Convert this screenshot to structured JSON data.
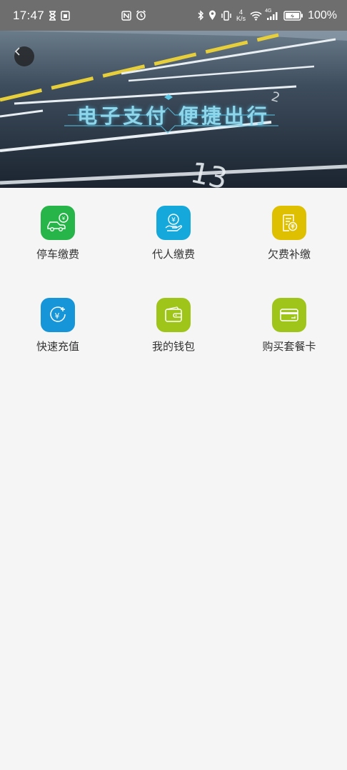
{
  "status_bar": {
    "time": "17:47",
    "net_speed_value": "4",
    "net_speed_unit": "K/s",
    "network_type": "4G",
    "battery": "100%"
  },
  "banner": {
    "title": "电子支付 便捷出行"
  },
  "services": [
    {
      "label": "停车缴费",
      "color": "#27b54a",
      "icon": "car-yuan-icon"
    },
    {
      "label": "代人缴费",
      "color": "#14a8db",
      "icon": "hand-yuan-icon"
    },
    {
      "label": "欠费补缴",
      "color": "#dfc000",
      "icon": "bill-icon"
    },
    {
      "label": "快速充值",
      "color": "#1795d9",
      "icon": "recharge-icon"
    },
    {
      "label": "我的钱包",
      "color": "#9fc41a",
      "icon": "wallet-icon"
    },
    {
      "label": "购买套餐卡",
      "color": "#9fc41a",
      "icon": "card-icon"
    }
  ]
}
